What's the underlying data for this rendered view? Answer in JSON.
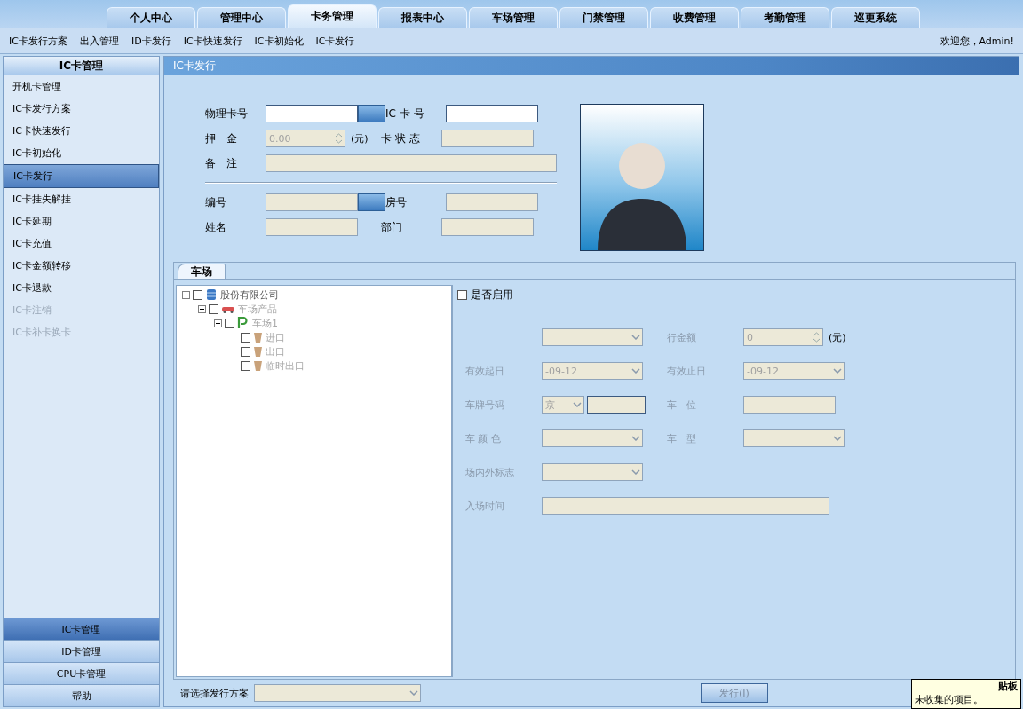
{
  "top_tabs": [
    {
      "label": "个人中心",
      "selected": false
    },
    {
      "label": "管理中心",
      "selected": false
    },
    {
      "label": "卡务管理",
      "selected": true
    },
    {
      "label": "报表中心",
      "selected": false
    },
    {
      "label": "车场管理",
      "selected": false
    },
    {
      "label": "门禁管理",
      "selected": false
    },
    {
      "label": "收费管理",
      "selected": false
    },
    {
      "label": "考勤管理",
      "selected": false
    },
    {
      "label": "巡更系统",
      "selected": false
    }
  ],
  "sub_menu": [
    "IC卡发行方案",
    "出入管理",
    "ID卡发行",
    "IC卡快速发行",
    "IC卡初始化",
    "IC卡发行"
  ],
  "welcome": "欢迎您，Admin!",
  "sidebar": {
    "title": "IC卡管理",
    "items": [
      {
        "label": "开机卡管理",
        "selected": false,
        "disabled": false
      },
      {
        "label": "IC卡发行方案",
        "selected": false,
        "disabled": false
      },
      {
        "label": "IC卡快速发行",
        "selected": false,
        "disabled": false
      },
      {
        "label": "IC卡初始化",
        "selected": false,
        "disabled": false
      },
      {
        "label": "IC卡发行",
        "selected": true,
        "disabled": false
      },
      {
        "label": "IC卡挂失解挂",
        "selected": false,
        "disabled": false
      },
      {
        "label": "IC卡延期",
        "selected": false,
        "disabled": false
      },
      {
        "label": "IC卡充值",
        "selected": false,
        "disabled": false
      },
      {
        "label": "IC卡金额转移",
        "selected": false,
        "disabled": false
      },
      {
        "label": "IC卡退款",
        "selected": false,
        "disabled": false
      },
      {
        "label": "IC卡注销",
        "selected": false,
        "disabled": true
      },
      {
        "label": "IC卡补卡换卡",
        "selected": false,
        "disabled": true
      }
    ],
    "bottom_nav": [
      {
        "label": "IC卡管理",
        "selected": true
      },
      {
        "label": "ID卡管理",
        "selected": false
      },
      {
        "label": "CPU卡管理",
        "selected": false
      },
      {
        "label": "帮助",
        "selected": false
      }
    ]
  },
  "panel": {
    "title": "IC卡发行",
    "card_rows": [
      [
        {
          "label": "物理卡号",
          "kind": "picker",
          "disabled": false
        },
        {
          "label": "IC 卡 号",
          "kind": "text",
          "disabled": false
        }
      ],
      [
        {
          "label": "押　金",
          "kind": "spin",
          "value": "0.00",
          "unit": "(元)",
          "disabled": true
        },
        {
          "label": "卡 状 态",
          "kind": "text",
          "disabled": true
        }
      ],
      [
        {
          "label": "备　注",
          "kind": "wide",
          "disabled": true
        }
      ]
    ],
    "person_rows": [
      [
        {
          "label": "编号",
          "kind": "picker",
          "disabled": true
        },
        {
          "label": "房号",
          "kind": "text",
          "disabled": true
        }
      ],
      [
        {
          "label": "姓名",
          "kind": "text",
          "disabled": true
        },
        {
          "label": "部门",
          "kind": "text",
          "disabled": true
        }
      ]
    ],
    "parking": {
      "tab": "车场",
      "tree": [
        {
          "label": "股份有限公司",
          "kind": "server",
          "checked": false,
          "disabled": false,
          "expanded": true,
          "children": [
            {
              "label": "车场产品",
              "kind": "car",
              "checked": false,
              "disabled": true,
              "expanded": true,
              "children": [
                {
                  "label": "车场1",
                  "kind": "parking",
                  "checked": false,
                  "disabled": true,
                  "expanded": true,
                  "children": [
                    {
                      "label": "进口",
                      "kind": "gate",
                      "checked": false,
                      "disabled": true
                    },
                    {
                      "label": "出口",
                      "kind": "gate",
                      "checked": false,
                      "disabled": true
                    },
                    {
                      "label": "临时出口",
                      "kind": "gate",
                      "checked": false,
                      "disabled": true
                    }
                  ]
                }
              ]
            }
          ]
        }
      ],
      "enable": {
        "label": "是否启用",
        "checked": false
      },
      "rows": [
        [
          {
            "kind": "select",
            "disabled": true
          },
          {
            "label": "行金额",
            "kind": "spin",
            "value": "0",
            "unit": "(元)",
            "disabled": true
          }
        ],
        [
          {
            "label": "有效起日",
            "kind": "select",
            "value": "-09-12",
            "disabled": true
          },
          {
            "label": "有效止日",
            "kind": "select",
            "value": "-09-12",
            "disabled": true
          }
        ],
        [
          {
            "label": "车牌号码",
            "kind": "plate",
            "value": "京",
            "disabled": true
          },
          {
            "label": "车　位",
            "kind": "text",
            "disabled": true
          }
        ],
        [
          {
            "label": "车 颜 色",
            "kind": "select",
            "disabled": true
          },
          {
            "label": "车　型",
            "kind": "select",
            "disabled": true
          }
        ],
        [
          {
            "label": "场内外标志",
            "kind": "select",
            "disabled": true
          }
        ],
        [
          {
            "label": "入场时间",
            "kind": "wide",
            "disabled": true
          }
        ]
      ]
    },
    "scheme": {
      "label": "请选择发行方案",
      "disabled": true
    },
    "buttons": [
      {
        "label": "发行(I)",
        "disabled": true
      }
    ]
  },
  "clipboard_popup": {
    "title": "贴板",
    "message": "未收集的项目。"
  }
}
